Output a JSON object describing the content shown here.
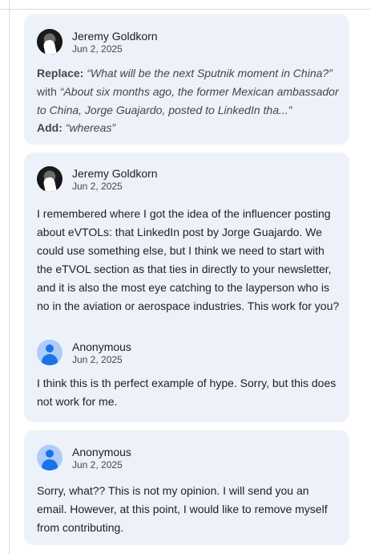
{
  "comments": [
    {
      "author": "Jeremy Goldkorn",
      "date": "Jun 2, 2025",
      "replace_label": "Replace:",
      "replace_old": "“What will be the next Sputnik moment in China?”",
      "with_label": "with",
      "replace_new": "“About six months ago, the former Mexican ambassador to China, Jorge Guajardo, posted to LinkedIn tha...”",
      "add_label": "Add:",
      "add_text": "“whereas”"
    },
    {
      "author": "Jeremy Goldkorn",
      "date": "Jun 2, 2025",
      "body": "I remembered where I got the idea of the influencer posting about eVTOLs: that LinkedIn post by Jorge Guajardo. We could use something else, but I think we need to start with the eTVOL section as that ties in directly to your newsletter, and it is also the most  eye catching to the layperson who is no in the aviation or aerospace industries. This work for you?",
      "reply": {
        "author": "Anonymous",
        "date": "Jun 2, 2025",
        "body": "I think this is th perfect example of hype. Sorry, but this does not work for me."
      }
    },
    {
      "author": "Anonymous",
      "date": "Jun 2, 2025",
      "body": "Sorry, what?? This is not my opinion. I will send you an email. However, at this point, I would like to remove myself from contributing."
    }
  ],
  "icons": {
    "author_photo": "profile-photo-avatar",
    "anonymous": "anonymous-user-icon"
  },
  "colors": {
    "card_bg": "#edf2fa",
    "anon_avatar_bg": "#aecbfa",
    "anon_avatar_fg": "#1a73e8"
  }
}
